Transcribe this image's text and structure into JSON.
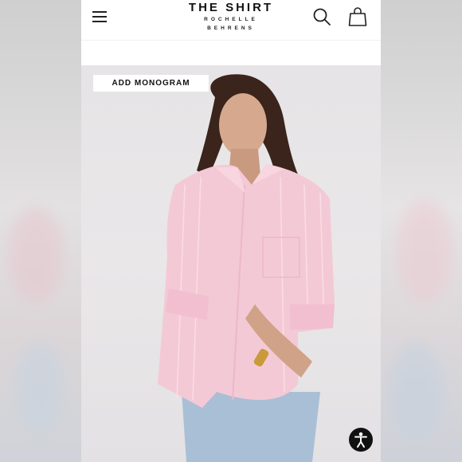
{
  "header": {
    "brand_title": "THE SHIRT",
    "brand_line1": "ROCHELLE",
    "brand_line2": "BEHRENS",
    "menu_icon": "hamburger-menu-icon",
    "search_icon": "search-icon",
    "bag_icon": "shopping-bag-icon"
  },
  "hero": {
    "monogram_label": "ADD MONOGRAM",
    "accessibility_icon": "accessibility-icon"
  },
  "colors": {
    "shirt": "#f4c9d6",
    "denim": "#a9bfd6",
    "background": "#e6e4e6",
    "accent": "#111111"
  }
}
